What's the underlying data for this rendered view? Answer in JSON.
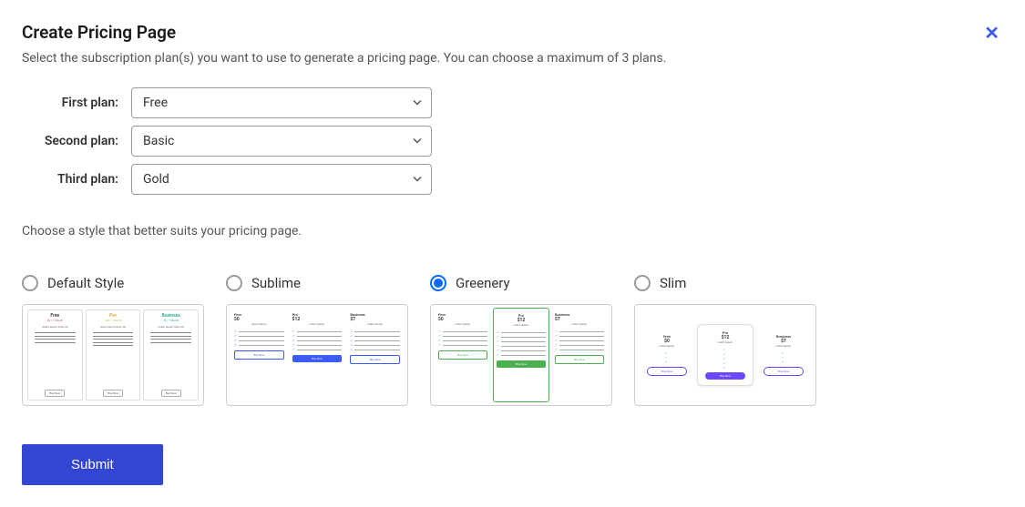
{
  "modal": {
    "title": "Create Pricing Page",
    "description": "Select the subscription plan(s) you want to use to generate a pricing page. You can choose a maximum of 3 plans.",
    "close_label": "✕"
  },
  "plans": {
    "first_label": "First plan:",
    "first_value": "Free",
    "second_label": "Second plan:",
    "second_value": "Basic",
    "third_label": "Third plan:",
    "third_value": "Gold"
  },
  "style_prompt": "Choose a style that better suits your pricing page.",
  "styles": [
    {
      "key": "default",
      "label": "Default Style",
      "selected": false
    },
    {
      "key": "sublime",
      "label": "Sublime",
      "selected": false
    },
    {
      "key": "greenery",
      "label": "Greenery",
      "selected": true
    },
    {
      "key": "slim",
      "label": "Slim",
      "selected": false
    }
  ],
  "preview": {
    "default": {
      "tiers": [
        "Free",
        "Pro",
        "Business"
      ],
      "sub": [
        "0$ / 1 Month",
        "12$ / 1 Month",
        "7$ / 1 Month"
      ],
      "btn": "Buy Now"
    },
    "sublime": {
      "tiers": [
        "Free",
        "Pro",
        "Business"
      ],
      "prices": [
        "$0",
        "$12",
        "$7"
      ],
      "btn": "Buy Now"
    },
    "greenery": {
      "tiers": [
        "Free",
        "Pro",
        "Business"
      ],
      "prices": [
        "$0",
        "$12",
        "$7"
      ],
      "btn": "Buy Now"
    },
    "slim": {
      "tiers": [
        "Free",
        "Pro",
        "Business"
      ],
      "prices": [
        "$0",
        "$12",
        "$7"
      ],
      "btn": "Buy Now"
    }
  },
  "submit_label": "Submit"
}
